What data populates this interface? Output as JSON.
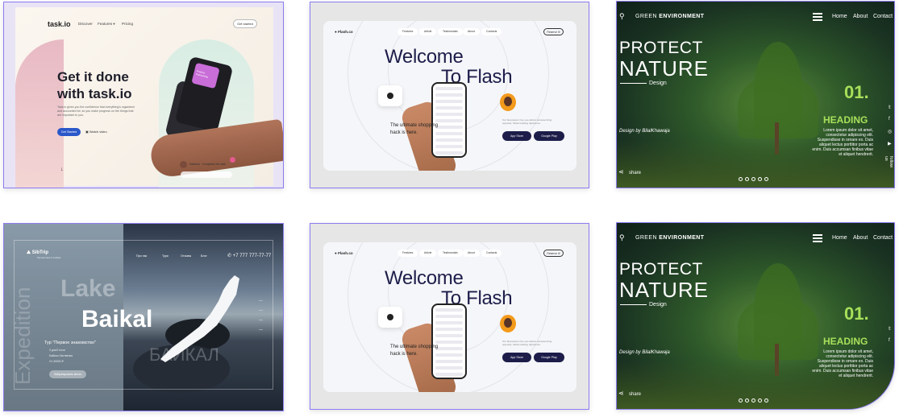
{
  "colors": {
    "frame": "#8b7cf0",
    "task_cta": "#2a57c9",
    "flash_navy": "#1d1d4a",
    "green_accent": "#a7e05a"
  },
  "task": {
    "logo": "task.io",
    "nav": [
      "Discover",
      "Features ▾",
      "Pricing"
    ],
    "top_button": "Get started",
    "headline_1": "Get it done",
    "headline_2": "with task.io",
    "body": "Task.io gives you the confidence that everything's organised and accounted for, so you make progress on the things that are important to you.",
    "cta": "Get Started",
    "watch": "Watch video",
    "card_caption": "Natasha · Completed the task",
    "card_sub": "Product Partnership",
    "arrow": "↓"
  },
  "flash": {
    "logo": "Flash.co",
    "nav": [
      "Features",
      "Article",
      "Testimonials",
      "About",
      "Contacts"
    ],
    "reserve": "Reserve it!",
    "headline_1": "Welcome",
    "headline_2": "To Flash",
    "tagline_1": "The ultimate shopping",
    "tagline_2": "hack is here.",
    "small_text": "Our fast-paced, free you-deliver accessorizing opposite, follow tracking rightnance.",
    "app_store": "App Store",
    "google_play": "Google Play"
  },
  "green": {
    "brand_1": "GREEN",
    "brand_2": "ENVIRONMENT",
    "nav": [
      "Home",
      "About",
      "Contact"
    ],
    "protect": "PROTECT",
    "nature": "NATURE",
    "design": "Design",
    "number": "01.",
    "heading": "HEADING",
    "lorem": "Lorem ipsum dolor sit amet, consectetur adipiscing elit. Suspendisse in ornare ex. Duis aliquet lectus porttitor porta ac enim. Duis accumsan finibus vitae et aliquet hendrerit.",
    "credit": "Design by BilalKhawaja",
    "share": "share",
    "follow": "follow us"
  },
  "baikal": {
    "logo": "SibTrip",
    "logo_sub": "Путешествия по Сибири",
    "nav": [
      "Про нас",
      "Тури",
      "Отзывы",
      "Блог"
    ],
    "phone": "+7 777 777-77-77",
    "lake": "Lake",
    "baikal": "Baikal",
    "vertical": "Expedition",
    "cyrillic": "БАЙКАЛ",
    "tour": "Тур \"Первое знакомство\"",
    "details": [
      "3 дня/2 ночи",
      "Байкал-Лиственка",
      "От 30000 ₽"
    ],
    "button": "Забронировать место"
  }
}
